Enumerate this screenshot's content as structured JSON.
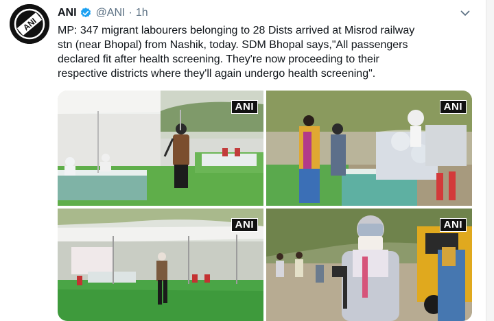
{
  "tweet": {
    "author_name": "ANI",
    "handle": "@ANI",
    "separator": "·",
    "time": "1h",
    "text_lines": [
      "MP: 347 migrant labourers belonging to 28 Dists arrived at Misrod railway",
      "stn (near Bhopal) from Nashik, today. SDM Bhopal says,\"All passengers",
      "declared fit after health screening. They're now proceeding to their",
      "respective districts where they'll again undergo health screening\"."
    ],
    "icons": {
      "avatar": "ani-logo-avatar",
      "verified": "verified-badge-icon",
      "menu": "chevron-down-icon"
    },
    "media": {
      "watermark": "ANI",
      "photos": [
        {
          "watermark": "ANI",
          "scene": "tent health screening desk"
        },
        {
          "watermark": "ANI",
          "scene": "passengers in queue"
        },
        {
          "watermark": "ANI",
          "scene": "man walking on lawn under tents"
        },
        {
          "watermark": "ANI",
          "scene": "official wearing mask speaking into microphone"
        }
      ]
    },
    "colors": {
      "verified": "#1da1f2",
      "muted_text": "#5b7083",
      "text": "#0f1419"
    }
  }
}
